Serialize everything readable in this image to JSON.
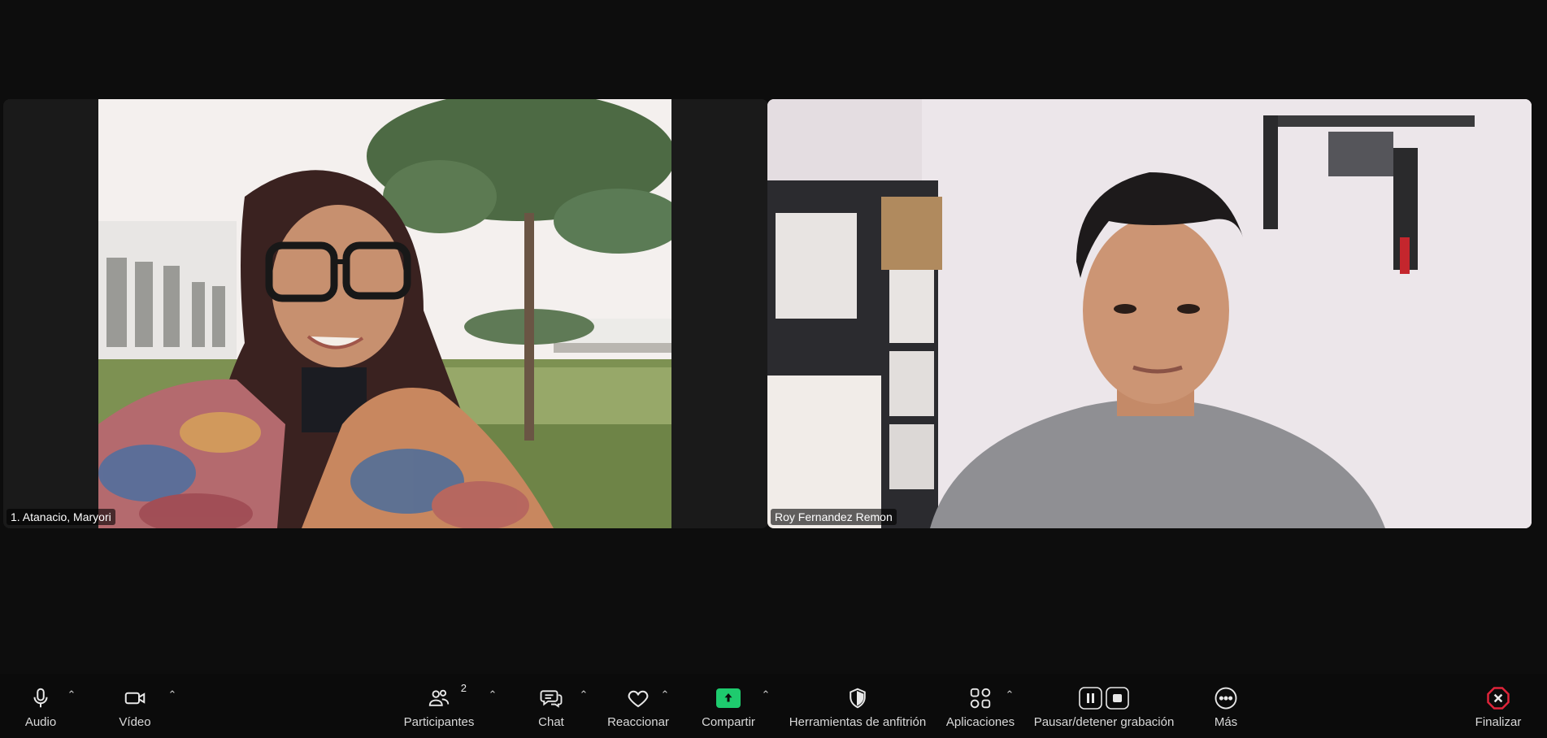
{
  "participants": [
    {
      "name": "1. Atanacio, Maryori"
    },
    {
      "name": "Roy Fernandez Remon"
    }
  ],
  "toolbar": {
    "audio": {
      "label": "Audio",
      "icon": "microphone-icon"
    },
    "video": {
      "label": "Vídeo",
      "icon": "video-camera-icon"
    },
    "participants": {
      "label": "Participantes",
      "count": "2",
      "icon": "participants-icon"
    },
    "chat": {
      "label": "Chat",
      "icon": "chat-icon"
    },
    "react": {
      "label": "Reaccionar",
      "icon": "heart-icon"
    },
    "share": {
      "label": "Compartir",
      "icon": "share-arrow-icon",
      "color": "#1ecb6e"
    },
    "host_tools": {
      "label": "Herramientas de anfitrión",
      "icon": "shield-icon"
    },
    "apps": {
      "label": "Aplicaciones",
      "icon": "apps-icon"
    },
    "record": {
      "label": "Pausar/detener grabación",
      "icon": "pause-stop-icon"
    },
    "more": {
      "label": "Más",
      "icon": "more-icon"
    },
    "end": {
      "label": "Finalizar",
      "icon": "end-call-icon",
      "color": "#e0243a"
    }
  }
}
